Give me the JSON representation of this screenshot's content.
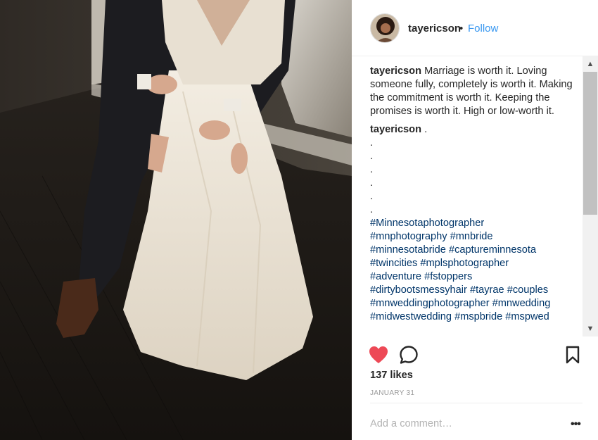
{
  "post": {
    "username": "tayericson",
    "separator": "•",
    "follow_label": "Follow"
  },
  "caption": {
    "username": "tayericson",
    "text": "Marriage is worth it. Loving someone fully, completely is worth it. Making the commitment is worth it. Keeping the promises is worth it. High or low-worth it."
  },
  "comment": {
    "username": "tayericson",
    "text": ".",
    "dots": [
      ".",
      ".",
      ".",
      ".",
      ".",
      "."
    ],
    "hashtag_lines": [
      [
        "#Minnesotaphotographer"
      ],
      [
        "#mnphotography",
        "#mnbride"
      ],
      [
        "#minnesotabride",
        "#captureminnesota"
      ],
      [
        "#twincities",
        "#mplsphotographer"
      ],
      [
        "#adventure",
        "#fstoppers"
      ],
      [
        "#dirtybootsmessyhair",
        "#tayrae",
        "#couples"
      ],
      [
        "#mnweddingphotographer",
        "#mnwedding"
      ],
      [
        "#midwestwedding",
        "#mspbride",
        "#mspwed"
      ]
    ]
  },
  "actions": {
    "like_icon": "heart-filled-icon",
    "comment_icon": "speech-bubble-icon",
    "save_icon": "bookmark-icon",
    "liked": true,
    "heart_color": "#ed4956"
  },
  "likes": "137 likes",
  "date": "JANUARY 31",
  "add_comment": {
    "placeholder": "Add a comment…",
    "more_label": "•••"
  },
  "colors": {
    "link": "#3897f0",
    "hashtag": "#003569",
    "muted": "#999999"
  }
}
